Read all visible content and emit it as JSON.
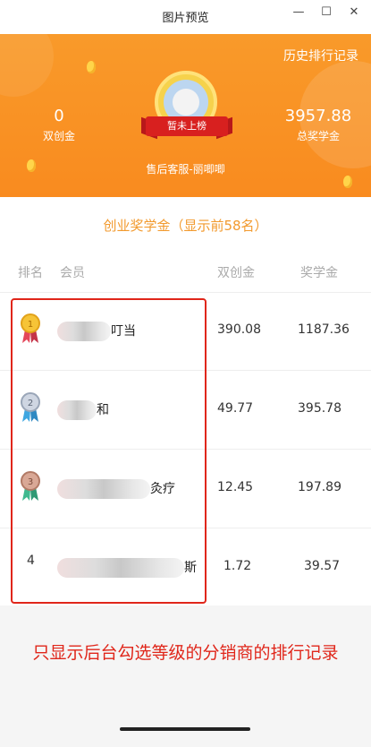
{
  "window": {
    "title": "图片预览",
    "minimize": "—",
    "maximize": "☐",
    "close": "✕"
  },
  "hero": {
    "history_link": "历史排行记录",
    "left_stat": {
      "value": "0",
      "label": "双创金"
    },
    "right_stat": {
      "value": "3957.88",
      "label": "总奖学金"
    },
    "badge": "暂未上榜",
    "service": "售后客服-丽唧唧"
  },
  "section_title": "创业奖学金（显示前58名）",
  "table": {
    "headers": [
      "排名",
      "会员",
      "双创金",
      "奖学金"
    ],
    "rows": [
      {
        "rank": "1",
        "name_suffix": "叮当",
        "double": "390.08",
        "scholarship": "1187.36",
        "medal": "gold"
      },
      {
        "rank": "2",
        "name_suffix": "和",
        "double": "49.77",
        "scholarship": "395.78",
        "medal": "silver"
      },
      {
        "rank": "3",
        "name_suffix": "灸疗",
        "double": "12.45",
        "scholarship": "197.89",
        "medal": "bronze"
      },
      {
        "rank": "4",
        "name_suffix": "斯",
        "double": "1.72",
        "scholarship": "39.57",
        "medal": ""
      }
    ]
  },
  "annotation": "只显示后台勾选等级的分销商的排行记录",
  "colors": {
    "accent": "#f99a2a",
    "title": "#f29a2e",
    "highlight": "#e0261a"
  }
}
